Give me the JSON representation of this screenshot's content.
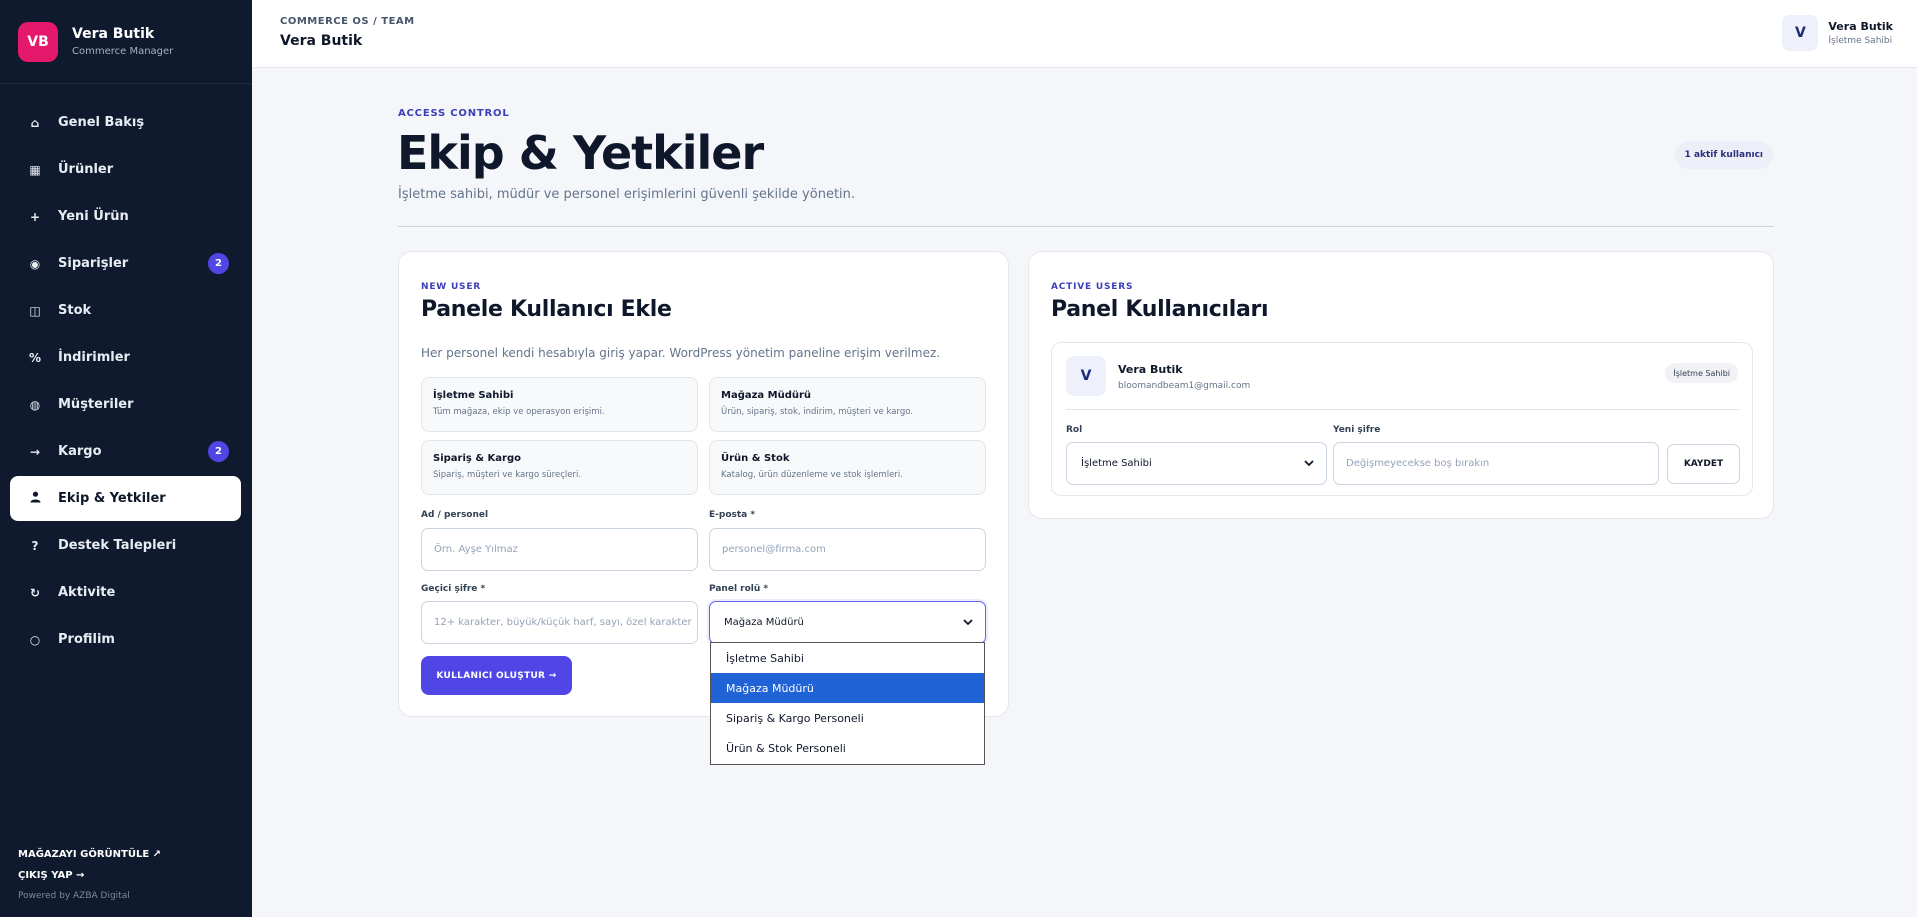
{
  "brand": {
    "logo": "VB",
    "name": "Vera Butik",
    "subtitle": "Commerce Manager",
    "logo_color": "#e5196b"
  },
  "sidebar": {
    "items": [
      {
        "icon": "home-icon",
        "glyph": "⌂",
        "label": "Genel Bakış"
      },
      {
        "icon": "box-icon",
        "glyph": "▦",
        "label": "Ürünler"
      },
      {
        "icon": "plus-icon",
        "glyph": "+",
        "label": "Yeni Ürün"
      },
      {
        "icon": "orders-icon",
        "glyph": "◉",
        "label": "Siparişler",
        "badge": "2"
      },
      {
        "icon": "stock-icon",
        "glyph": "◫",
        "label": "Stok"
      },
      {
        "icon": "percent-icon",
        "glyph": "%",
        "label": "İndirimler"
      },
      {
        "icon": "customers-icon",
        "glyph": "◍",
        "label": "Müşteriler"
      },
      {
        "icon": "arrow-right-icon",
        "glyph": "→",
        "label": "Kargo",
        "badge": "2"
      },
      {
        "icon": "user-icon",
        "glyph": "👤",
        "label": "Ekip & Yetkiler",
        "active": true
      },
      {
        "icon": "question-icon",
        "glyph": "?",
        "label": "Destek Talepleri"
      },
      {
        "icon": "refresh-icon",
        "glyph": "↻",
        "label": "Aktivite"
      },
      {
        "icon": "circle-icon",
        "glyph": "○",
        "label": "Profilim"
      }
    ],
    "footer": {
      "view_store": "MAĞAZAYI GÖRÜNTÜLE ↗",
      "logout": "ÇIKIŞ YAP →",
      "powered": "Powered by AZBA Digital"
    }
  },
  "topbar": {
    "breadcrumb": "COMMERCE OS / TEAM",
    "title": "Vera Butik",
    "user": {
      "avatar": "V",
      "name": "Vera Butik",
      "role": "İşletme Sahibi"
    }
  },
  "page": {
    "eyebrow": "ACCESS CONTROL",
    "title": "Ekip & Yetkiler",
    "description": "İşletme sahibi, müdür ve personel erişimlerini güvenli şekilde yönetin.",
    "active_count": "1 aktif kullanıcı"
  },
  "new_user": {
    "eyebrow": "NEW USER",
    "title": "Panele Kullanıcı Ekle",
    "description": "Her personel kendi hesabıyla giriş yapar. WordPress yönetim paneline erişim verilmez.",
    "roles": [
      {
        "name": "İşletme Sahibi",
        "desc": "Tüm mağaza, ekip ve operasyon erişimi."
      },
      {
        "name": "Mağaza Müdürü",
        "desc": "Ürün, sipariş, stok, indirim, müşteri ve kargo."
      },
      {
        "name": "Sipariş & Kargo",
        "desc": "Sipariş, müşteri ve kargo süreçleri."
      },
      {
        "name": "Ürün & Stok",
        "desc": "Katalog, ürün düzenleme ve stok işlemleri."
      }
    ],
    "name_label": "Ad / personel",
    "name_placeholder": "Örn. Ayşe Yılmaz",
    "email_label": "E-posta *",
    "email_placeholder": "personel@firma.com",
    "password_label": "Geçici şifre *",
    "password_placeholder": "12+ karakter, büyük/küçük harf, sayı, özel karakter",
    "role_label": "Panel rolü *",
    "role_selected": "Mağaza Müdürü",
    "role_options": [
      "İşletme Sahibi",
      "Mağaza Müdürü",
      "Sipariş & Kargo Personeli",
      "Ürün & Stok Personeli"
    ],
    "submit": "KULLANICI OLUŞTUR →"
  },
  "active_users": {
    "eyebrow": "ACTIVE USERS",
    "title": "Panel Kullanıcıları",
    "users": [
      {
        "avatar": "V",
        "name": "Vera Butik",
        "email": "bloomandbeam1@gmail.com",
        "badge": "İşletme Sahibi",
        "role_label": "Rol",
        "role_value": "İşletme Sahibi",
        "password_label": "Yeni şifre",
        "password_placeholder": "Değişmeyecekse boş bırakın",
        "save": "KAYDET"
      }
    ]
  },
  "colors": {
    "accent": "#4f46e5",
    "sidebar": "#0f1a2e",
    "selected_option": "#1f63d6"
  }
}
